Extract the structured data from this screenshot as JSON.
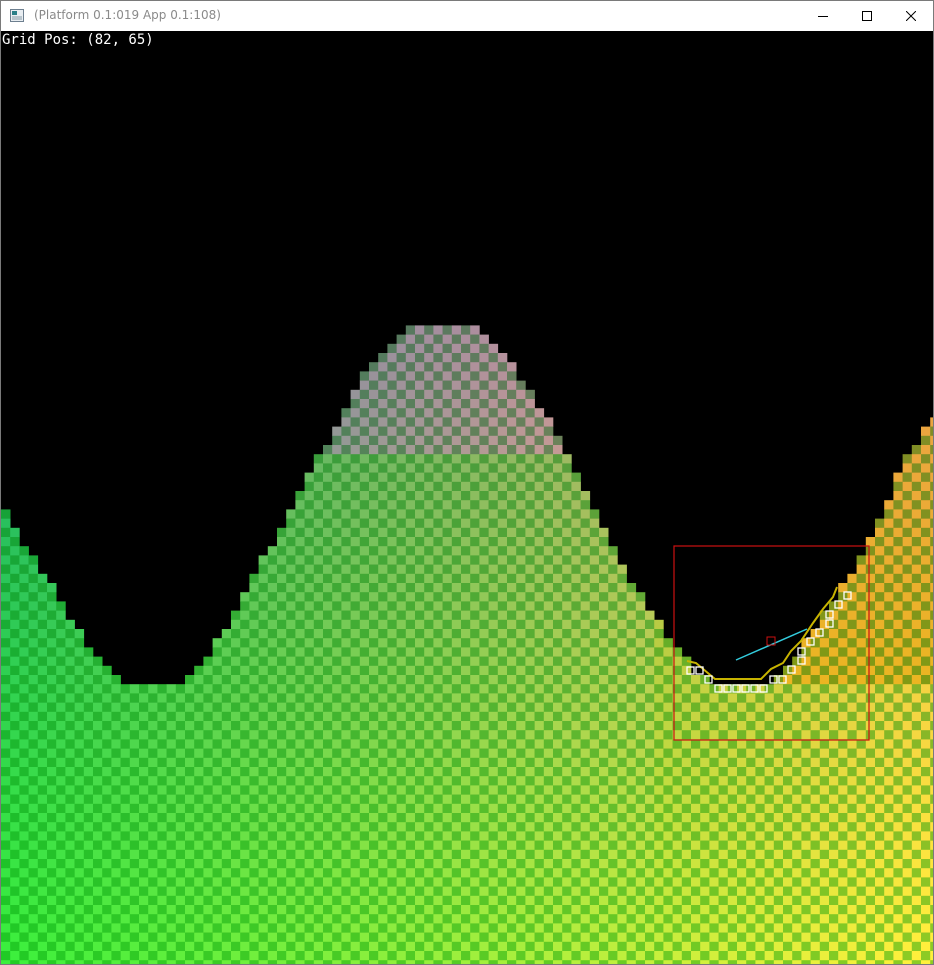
{
  "window": {
    "title": "(Platform 0.1:019 App 0.1:108)",
    "controls": {
      "minimize_icon": "minimize-icon",
      "maximize_icon": "maximize-icon",
      "close_icon": "close-icon"
    }
  },
  "hud": {
    "grid_pos_text": "Grid Pos: (82, 65)"
  },
  "game": {
    "background_color": "#000000",
    "selection_box_color": "#cc1111",
    "path_color": "#c8b400",
    "ray_color": "#33ccdd",
    "target_marker_color": "#cc1111",
    "path_node_border_color": "#ffffff"
  }
}
